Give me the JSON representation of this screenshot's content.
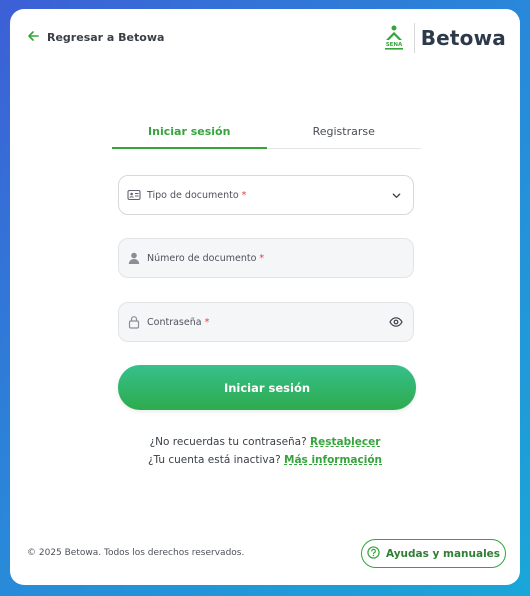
{
  "header": {
    "back_label": "Regresar a Betowa",
    "brand": "Betowa",
    "sena_logo_text": "SENA"
  },
  "tabs": [
    {
      "label": "Iniciar sesión",
      "active": true
    },
    {
      "label": "Registrarse",
      "active": false
    }
  ],
  "form": {
    "doc_type": {
      "label": "Tipo de documento",
      "required_mark": "*"
    },
    "doc_number": {
      "label": "Número de documento",
      "required_mark": "*"
    },
    "password": {
      "label": "Contraseña",
      "required_mark": "*"
    },
    "submit_label": "Iniciar sesión"
  },
  "help": {
    "forgot_text": "¿No recuerdas tu contraseña?",
    "forgot_link": "Restablecer",
    "inactive_text": "¿Tu cuenta está inactiva?",
    "inactive_link": "Más información"
  },
  "footer": {
    "copyright": "© 2025 Betowa. Todos los derechos reservados.",
    "manuals_label": "Ayudas y manuales"
  },
  "colors": {
    "accent": "#35a53b",
    "button_gradient_top": "#36c08b",
    "button_gradient_bottom": "#2eab4e",
    "background_from": "#3d5fd6",
    "background_to": "#1aa6d8"
  },
  "icons": [
    "arrow-left-icon",
    "sena-logo-icon",
    "id-card-icon",
    "chevron-down-icon",
    "user-icon",
    "lock-icon",
    "eye-icon",
    "help-circle-icon"
  ]
}
